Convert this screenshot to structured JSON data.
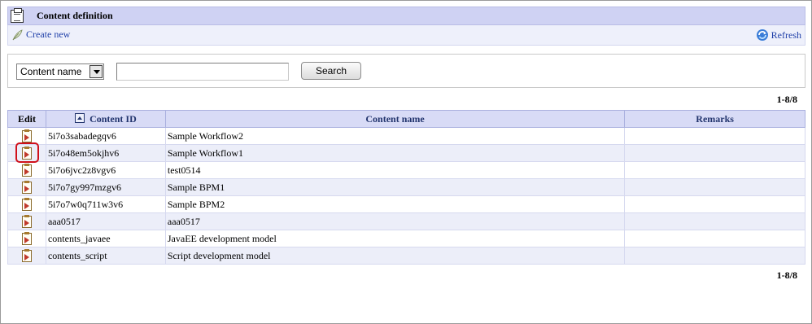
{
  "header": {
    "title": "Content definition",
    "icon": "clipboard-icon"
  },
  "toolbar": {
    "create_label": "Create new",
    "refresh_label": "Refresh"
  },
  "search": {
    "field_selected": "Content name",
    "query_value": "",
    "button_label": "Search"
  },
  "pager": {
    "top": "1-8/8",
    "bottom": "1-8/8"
  },
  "table": {
    "columns": [
      "Edit",
      "Content ID",
      "Content name",
      "Remarks"
    ],
    "rows": [
      {
        "id": "5i7o3sabadegqv6",
        "name": "Sample Workflow2",
        "remarks": ""
      },
      {
        "id": "5i7o48em5okjhv6",
        "name": "Sample Workflow1",
        "remarks": ""
      },
      {
        "id": "5i7o6jvc2z8vgv6",
        "name": "test0514",
        "remarks": ""
      },
      {
        "id": "5i7o7gy997mzgv6",
        "name": "Sample BPM1",
        "remarks": ""
      },
      {
        "id": "5i7o7w0q711w3v6",
        "name": "Sample BPM2",
        "remarks": ""
      },
      {
        "id": "aaa0517",
        "name": "aaa0517",
        "remarks": ""
      },
      {
        "id": "contents_javaee",
        "name": "JavaEE development model",
        "remarks": ""
      },
      {
        "id": "contents_script",
        "name": "Script development model",
        "remarks": ""
      }
    ]
  },
  "colors": {
    "header_bg": "#cfd2f3",
    "link": "#1f3fa8",
    "highlight": "#d0101b"
  }
}
